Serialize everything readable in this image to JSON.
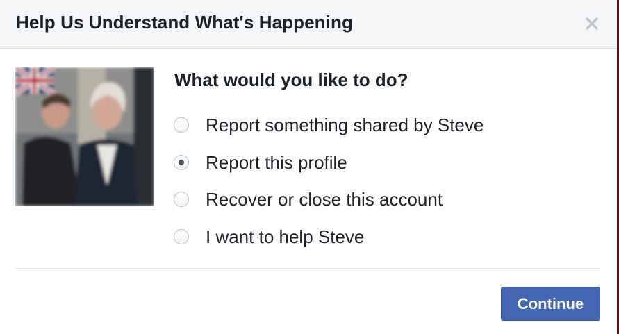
{
  "dialog": {
    "title": "Help Us Understand What's Happening",
    "close_icon": "close-icon"
  },
  "profile": {
    "photo_alt": "Profile photo"
  },
  "form": {
    "question": "What would you like to do?",
    "options": [
      {
        "label": "Report something shared by Steve",
        "checked": false
      },
      {
        "label": "Report this profile",
        "checked": true
      },
      {
        "label": "Recover or close this account",
        "checked": false
      },
      {
        "label": "I want to help Steve",
        "checked": false
      }
    ]
  },
  "footer": {
    "continue_label": "Continue"
  },
  "colors": {
    "header_bg": "#f5f6f7",
    "button_bg": "#4267b2",
    "text": "#1d2129"
  }
}
